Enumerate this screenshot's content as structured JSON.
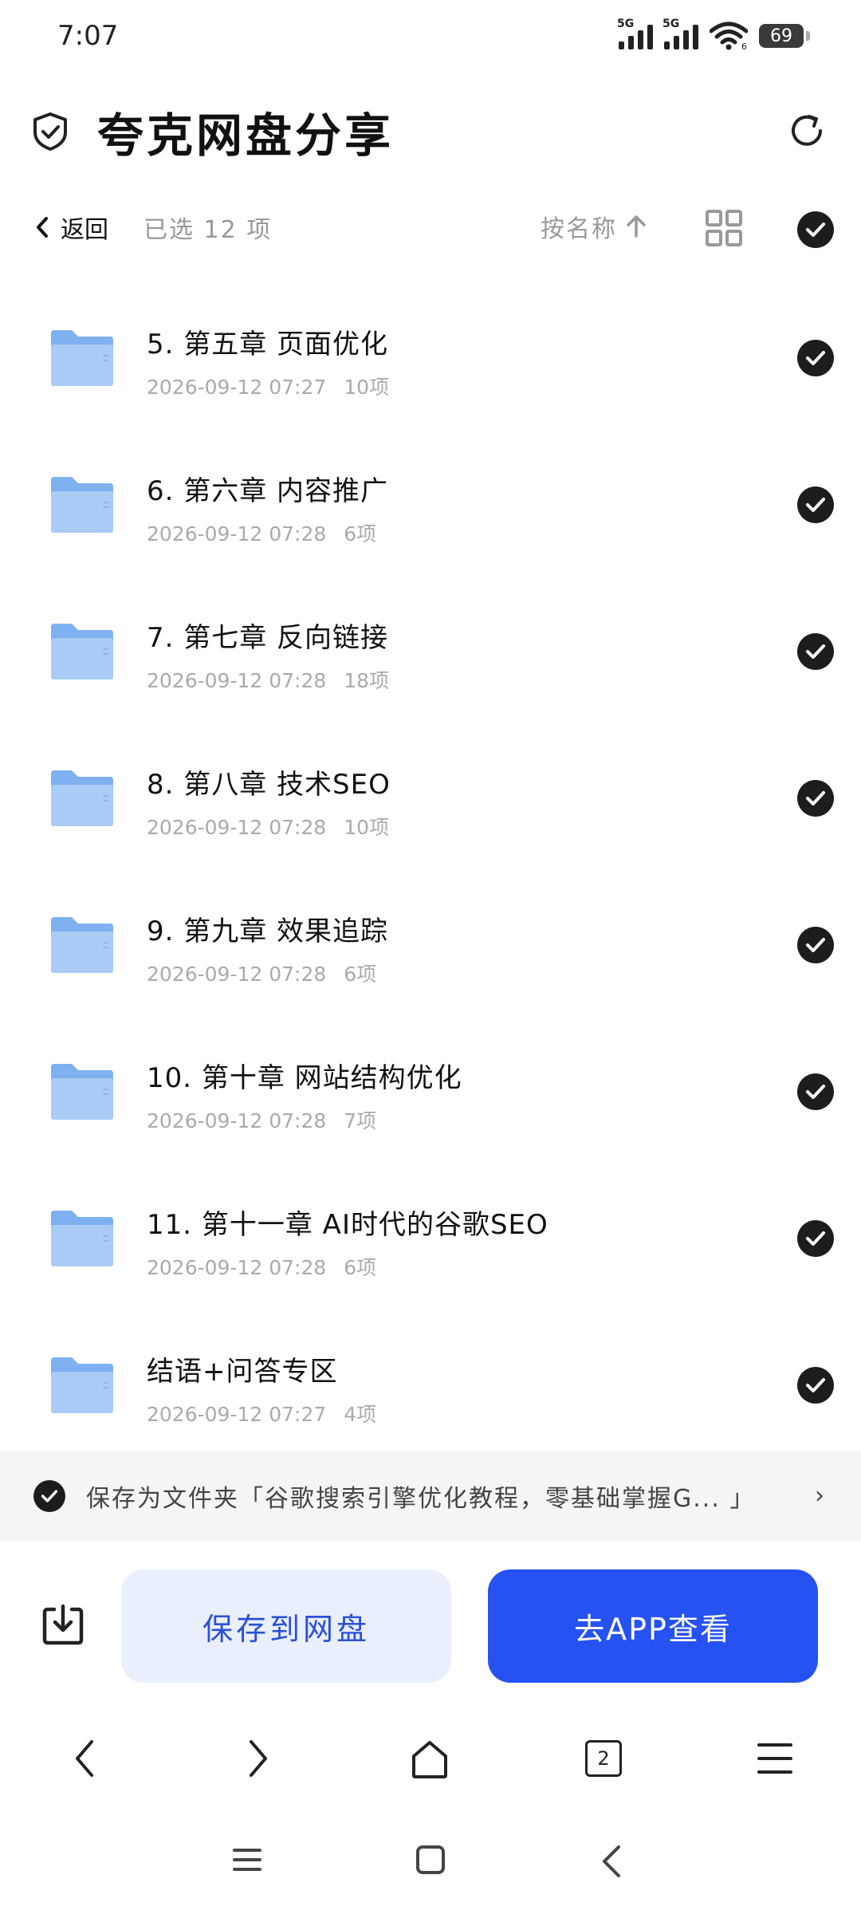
{
  "status_bar": {
    "time": "7:07",
    "network_1": "5G",
    "network_2": "5G",
    "wifi_badge": "6",
    "battery": "69"
  },
  "header": {
    "title": "夸克网盘分享"
  },
  "toolbar": {
    "back_label": "返回",
    "selected_count": "已选 12 项",
    "sort_label": "按名称"
  },
  "files": [
    {
      "name": "5. 第五章 页面优化",
      "date": "2026-09-12 07:27",
      "count": "10项"
    },
    {
      "name": "6. 第六章 内容推广",
      "date": "2026-09-12 07:28",
      "count": "6项"
    },
    {
      "name": "7. 第七章 反向链接",
      "date": "2026-09-12 07:28",
      "count": "18项"
    },
    {
      "name": "8. 第八章 技术SEO",
      "date": "2026-09-12 07:28",
      "count": "10项"
    },
    {
      "name": "9. 第九章 效果追踪",
      "date": "2026-09-12 07:28",
      "count": "6项"
    },
    {
      "name": "10. 第十章 网站结构优化",
      "date": "2026-09-12 07:28",
      "count": "7项"
    },
    {
      "name": "11. 第十一章 AI时代的谷歌SEO",
      "date": "2026-09-12 07:28",
      "count": "6项"
    },
    {
      "name": "结语+问答专区",
      "date": "2026-09-12 07:27",
      "count": "4项"
    }
  ],
  "save_path": {
    "text": "保存为文件夹「谷歌搜索引擎优化教程，零基础掌握G... 」"
  },
  "actions": {
    "save_label": "保存到网盘",
    "app_label": "去APP查看"
  },
  "browser_nav": {
    "tabs_count": "2"
  },
  "colors": {
    "accent": "#2552f1",
    "accent_light": "#e9effc",
    "folder": "#7fb0f0",
    "check": "#1d1d1d"
  }
}
